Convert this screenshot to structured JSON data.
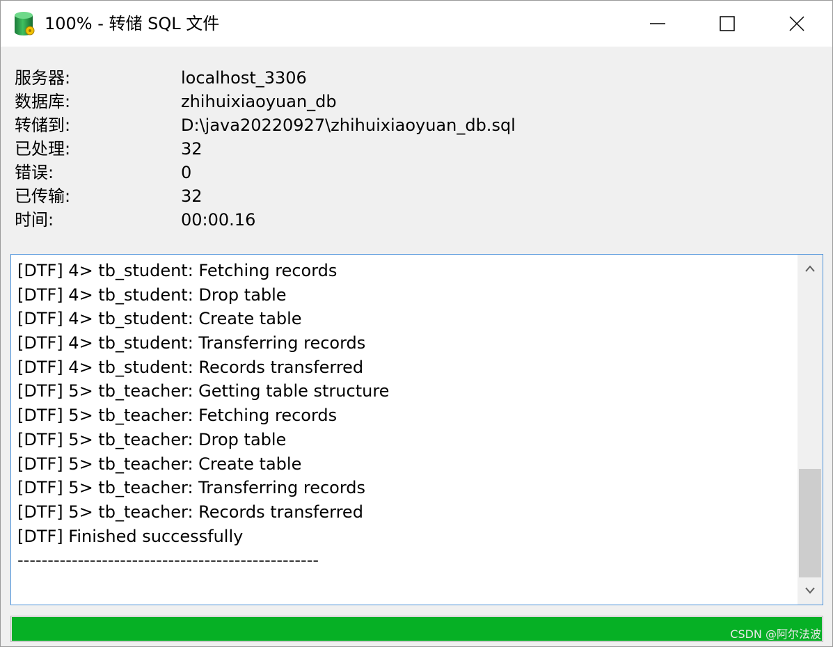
{
  "window": {
    "title": "100% - 转储 SQL 文件",
    "icon": "database-icon"
  },
  "info": [
    {
      "label": "服务器:",
      "value": "localhost_3306"
    },
    {
      "label": "数据库:",
      "value": "zhihuixiaoyuan_db"
    },
    {
      "label": "转储到:",
      "value": "D:\\java20220927\\zhihuixiaoyuan_db.sql"
    },
    {
      "label": "已处理:",
      "value": "32"
    },
    {
      "label": "错误:",
      "value": "0"
    },
    {
      "label": "已传输:",
      "value": "32"
    },
    {
      "label": "时间:",
      "value": "00:00.16"
    }
  ],
  "log": [
    "[DTF] 4> tb_student: Fetching records",
    "[DTF] 4> tb_student: Drop table",
    "[DTF] 4> tb_student: Create table",
    "[DTF] 4> tb_student: Transferring records",
    "[DTF] 4> tb_student: Records transferred",
    "[DTF] 5> tb_teacher: Getting table structure",
    "[DTF] 5> tb_teacher: Fetching records",
    "[DTF] 5> tb_teacher: Drop table",
    "[DTF] 5> tb_teacher: Create table",
    "[DTF] 5> tb_teacher: Transferring records",
    "[DTF] 5> tb_teacher: Records transferred",
    "[DTF] Finished successfully",
    "--------------------------------------------------"
  ],
  "progress": {
    "percent": 100,
    "color": "#06b025"
  },
  "watermark": "CSDN @阿尔法波",
  "colors": {
    "log_border": "#4a90d9",
    "background": "#f0f0f0"
  }
}
